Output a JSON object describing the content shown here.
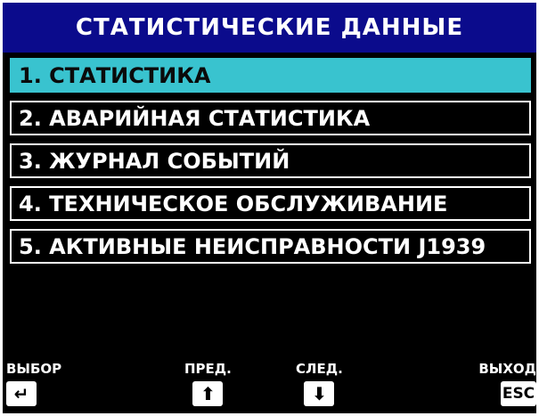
{
  "title": "СТАТИСТИЧЕСКИЕ ДАННЫЕ",
  "menu": {
    "items": [
      {
        "label": "1. СТАТИСТИКА"
      },
      {
        "label": "2. АВАРИЙНАЯ СТАТИСТИКА"
      },
      {
        "label": "3. ЖУРНАЛ СОБЫТИЙ"
      },
      {
        "label": "4. ТЕХНИЧЕСКОЕ ОБСЛУЖИВАНИЕ"
      },
      {
        "label": "5. АКТИВНЫЕ НЕИСПРАВНОСТИ J1939"
      }
    ],
    "selected_index": 0
  },
  "softkeys": {
    "select": {
      "label": "ВЫБОР",
      "icon": "enter-icon",
      "glyph": "↵"
    },
    "prev": {
      "label": "ПРЕД.",
      "icon": "arrow-up-icon",
      "glyph": "⬆"
    },
    "next": {
      "label": "СЛЕД.",
      "icon": "arrow-down-icon",
      "glyph": "⬇"
    },
    "exit": {
      "label": "ВЫХОД",
      "icon": "esc-key-icon",
      "glyph": "ESC"
    }
  },
  "colors": {
    "title_bg": "#0b0b8c",
    "selected_bg": "#39c3cf",
    "screen_bg": "#000000",
    "text": "#ffffff"
  }
}
